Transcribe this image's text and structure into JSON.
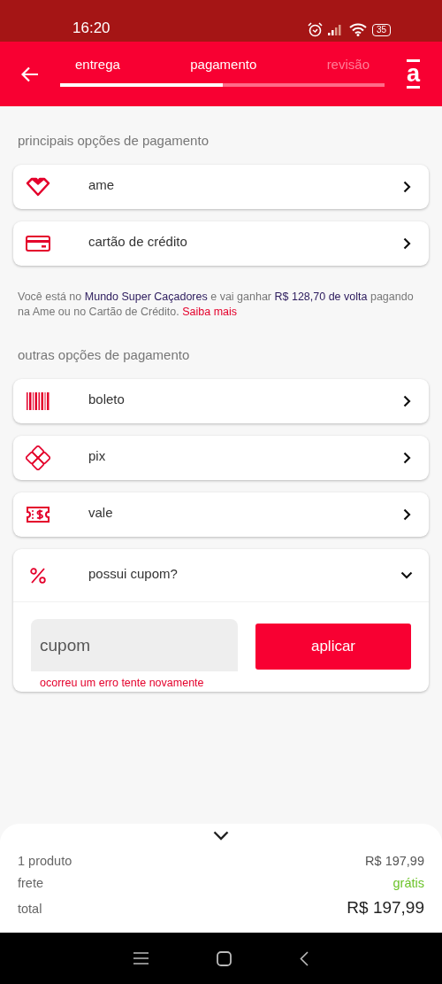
{
  "status_bar": {
    "time": "16:20",
    "battery": "35"
  },
  "header": {
    "logo": "a",
    "progress": {
      "level": 0.5
    },
    "steps": [
      {
        "label": "entrega",
        "reached": true
      },
      {
        "label": "pagamento",
        "reached": true
      },
      {
        "label": "revisão",
        "reached": false
      }
    ]
  },
  "main_options": {
    "title": "principais opções de pagamento",
    "items": [
      {
        "label": "ame"
      },
      {
        "label": "cartão de crédito"
      }
    ]
  },
  "cashback_note": {
    "text": "Você está no **Mundo Super Caçadores** e vai ganhar **R$ 128,70 de volta** pagando na Ame ou no Cartão de Crédito.",
    "link": "Saiba mais"
  },
  "other_options": {
    "title": "outras opções de pagamento",
    "items": [
      {
        "label": "boleto"
      },
      {
        "label": "pix"
      },
      {
        "label": "vale"
      }
    ]
  },
  "coupon": {
    "label": "possui cupom?",
    "expanded": true,
    "placeholder": "cupom",
    "button": "aplicar",
    "error": "ocorreu um erro tente novamente"
  },
  "summary": {
    "rows": [
      {
        "label": "1 produto",
        "value": "R$ 197,99",
        "kind": "item"
      },
      {
        "label": "frete",
        "value": "grátis",
        "kind": "shipping"
      },
      {
        "label": "total",
        "value": "R$ 197,99",
        "kind": "total"
      }
    ]
  }
}
